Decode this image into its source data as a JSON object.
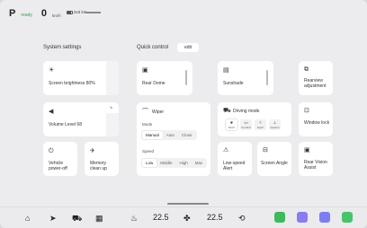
{
  "status_bar": {
    "gear": "P",
    "gear_mode": "ready",
    "speed": "0",
    "speed_unit": "km/h",
    "range": "318 km"
  },
  "system_settings": {
    "title": "System settings",
    "screen_brightness_label": "Screen brightness  80%",
    "volume_label": "Volume Level  68",
    "vehicle_power_off_label": "Vehicle power-off",
    "memory_clean_label": "Memory clean up"
  },
  "quick_control": {
    "title": "Quick control",
    "edit_label": "edit",
    "rear_dome_label": "Rear Dome",
    "sunshade_label": "Sunshade",
    "rearview_label": "Rearview adjustment",
    "wiper": {
      "title": "Wiper",
      "mode_label": "Mode",
      "mode_options": [
        "Manual",
        "Auto",
        "Close"
      ],
      "mode_selected": "Manual",
      "speed_label": "Speed",
      "speed_options": [
        "Low",
        "Middle",
        "High",
        "Max"
      ],
      "speed_selected": "Low"
    },
    "driving_mode": {
      "title": "Driving mode",
      "options": [
        "ECO",
        "Comfort",
        "Sport",
        "Custom"
      ],
      "selected": "ECO"
    },
    "window_lock_label": "Window lock",
    "low_speed_alert_label": "Low-speed Alert",
    "screen_angle_label": "Screen Angle",
    "rear_vision_label": "Rear Vision Assist"
  },
  "dock": {
    "left_temp": "22.5",
    "right_temp": "22.5",
    "app_colors": [
      "#3dbb5a",
      "#8a7cf0",
      "#7b7ef2",
      "#48c46a"
    ]
  }
}
